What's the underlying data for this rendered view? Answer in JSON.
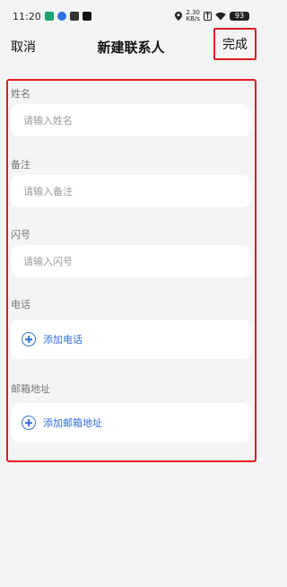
{
  "status_bar": {
    "time": "11:20",
    "net_speed_top": "2.30",
    "net_speed_bottom": "KB/s",
    "battery": "93"
  },
  "header": {
    "cancel": "取消",
    "title": "新建联系人",
    "done": "完成"
  },
  "form": {
    "name": {
      "label": "姓名",
      "placeholder": "请输入姓名"
    },
    "note": {
      "label": "备注",
      "placeholder": "请输入备注"
    },
    "flash": {
      "label": "闪号",
      "placeholder": "请输入闪号"
    },
    "phone": {
      "label": "电话",
      "add_text": "添加电话"
    },
    "email": {
      "label": "邮箱地址",
      "add_text": "添加邮箱地址"
    }
  },
  "colors": {
    "accent": "#2f6fdb",
    "highlight": "#e01d1d",
    "background": "#f3f4f6"
  }
}
